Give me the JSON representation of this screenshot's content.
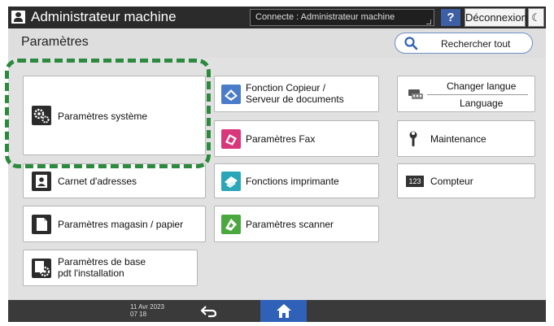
{
  "topbar": {
    "user_label": "Administrateur machine",
    "status": "Connecte : Administrateur machine",
    "help_label": "?",
    "logout_label": "Déconnexion",
    "moon_label": "☾"
  },
  "header": {
    "title": "Paramètres",
    "search_label": "Rechercher tout"
  },
  "tiles": {
    "systeme": "Paramètres système",
    "copieur_line1": "Fonction Copieur /",
    "copieur_line2": "Serveur de documents",
    "fax": "Paramètres Fax",
    "carnet": "Carnet d'adresses",
    "imprimante": "Fonctions imprimante",
    "magasin": "Paramètres magasin / papier",
    "scanner": "Paramètres scanner",
    "base_line1": "Paramètres de base",
    "base_line2": "pdt l'installation",
    "langue_line1": "Changer langue",
    "langue_line2": "Language",
    "maintenance": "Maintenance",
    "compteur_badge": "123",
    "compteur": "Compteur"
  },
  "bottombar": {
    "date": "11 Avr 2023",
    "time": "07 18"
  },
  "colors": {
    "highlight": "#2b8a3e",
    "home": "#2f61b8",
    "help": "#3d5fa3"
  }
}
